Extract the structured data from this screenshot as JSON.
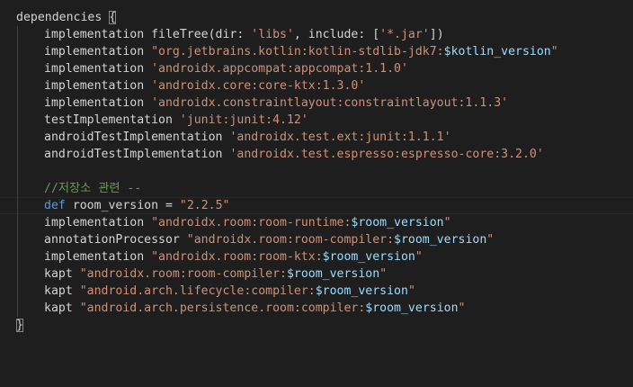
{
  "lines": [
    {
      "indent": false,
      "tokens": [
        {
          "t": "plain",
          "v": "dependencies "
        },
        {
          "t": "brace",
          "v": "{"
        }
      ]
    },
    {
      "indent": true,
      "tokens": [
        {
          "t": "plain",
          "v": "implementation fileTree(dir: "
        },
        {
          "t": "str",
          "v": "'libs'"
        },
        {
          "t": "plain",
          "v": ", include: ["
        },
        {
          "t": "str",
          "v": "'*.jar'"
        },
        {
          "t": "plain",
          "v": "])"
        }
      ]
    },
    {
      "indent": true,
      "tokens": [
        {
          "t": "plain",
          "v": "implementation "
        },
        {
          "t": "str",
          "v": "\"org.jetbrains.kotlin:kotlin-stdlib-jdk7:"
        },
        {
          "t": "var",
          "v": "$kotlin_version"
        },
        {
          "t": "str",
          "v": "\""
        }
      ]
    },
    {
      "indent": true,
      "tokens": [
        {
          "t": "plain",
          "v": "implementation "
        },
        {
          "t": "str",
          "v": "'androidx.appcompat:appcompat:1.1.0'"
        }
      ]
    },
    {
      "indent": true,
      "tokens": [
        {
          "t": "plain",
          "v": "implementation "
        },
        {
          "t": "str",
          "v": "'androidx.core:core-ktx:1.3.0'"
        }
      ]
    },
    {
      "indent": true,
      "tokens": [
        {
          "t": "plain",
          "v": "implementation "
        },
        {
          "t": "str",
          "v": "'androidx.constraintlayout:constraintlayout:1.1.3'"
        }
      ]
    },
    {
      "indent": true,
      "tokens": [
        {
          "t": "plain",
          "v": "testImplementation "
        },
        {
          "t": "str",
          "v": "'junit:junit:4.12'"
        }
      ]
    },
    {
      "indent": true,
      "tokens": [
        {
          "t": "plain",
          "v": "androidTestImplementation "
        },
        {
          "t": "str",
          "v": "'androidx.test.ext:junit:1.1.1'"
        }
      ]
    },
    {
      "indent": true,
      "tokens": [
        {
          "t": "plain",
          "v": "androidTestImplementation "
        },
        {
          "t": "str",
          "v": "'androidx.test.espresso:espresso-core:3.2.0'"
        }
      ]
    },
    {
      "indent": true,
      "tokens": []
    },
    {
      "indent": true,
      "tokens": [
        {
          "t": "cmt",
          "v": "//저장소 관련 --"
        }
      ]
    },
    {
      "indent": true,
      "cursor": true,
      "tokens": [
        {
          "t": "kw",
          "v": "def"
        },
        {
          "t": "plain",
          "v": " room_version = "
        },
        {
          "t": "str",
          "v": "\"2.2.5\""
        }
      ]
    },
    {
      "indent": true,
      "tokens": [
        {
          "t": "plain",
          "v": "implementation "
        },
        {
          "t": "str",
          "v": "\"androidx.room:room-runtime:"
        },
        {
          "t": "var",
          "v": "$room_version"
        },
        {
          "t": "str",
          "v": "\""
        }
      ]
    },
    {
      "indent": true,
      "tokens": [
        {
          "t": "plain",
          "v": "annotationProcessor "
        },
        {
          "t": "str",
          "v": "\"androidx.room:room-compiler:"
        },
        {
          "t": "var",
          "v": "$room_version"
        },
        {
          "t": "str",
          "v": "\""
        }
      ]
    },
    {
      "indent": true,
      "tokens": [
        {
          "t": "plain",
          "v": "implementation "
        },
        {
          "t": "str",
          "v": "\"androidx.room:room-ktx:"
        },
        {
          "t": "var",
          "v": "$room_version"
        },
        {
          "t": "str",
          "v": "\""
        }
      ]
    },
    {
      "indent": true,
      "tokens": [
        {
          "t": "plain",
          "v": "kapt "
        },
        {
          "t": "str",
          "v": "\"androidx.room:room-compiler:"
        },
        {
          "t": "var",
          "v": "$room_version"
        },
        {
          "t": "str",
          "v": "\""
        }
      ]
    },
    {
      "indent": true,
      "tokens": [
        {
          "t": "plain",
          "v": "kapt "
        },
        {
          "t": "str",
          "v": "\"android.arch.lifecycle:compiler:"
        },
        {
          "t": "var",
          "v": "$room_version"
        },
        {
          "t": "str",
          "v": "\""
        }
      ]
    },
    {
      "indent": true,
      "tokens": [
        {
          "t": "plain",
          "v": "kapt "
        },
        {
          "t": "str",
          "v": "\"android.arch.persistence.room:compiler:"
        },
        {
          "t": "var",
          "v": "$room_version"
        },
        {
          "t": "str",
          "v": "\""
        }
      ]
    },
    {
      "indent": false,
      "tokens": [
        {
          "t": "brace",
          "v": "}"
        }
      ]
    }
  ],
  "colors": {
    "background": "#1e1e1e",
    "plain": "#d4d4d4",
    "string": "#ce9178",
    "variable": "#9cdcfe",
    "keyword": "#569cd6",
    "comment": "#6a9955"
  }
}
